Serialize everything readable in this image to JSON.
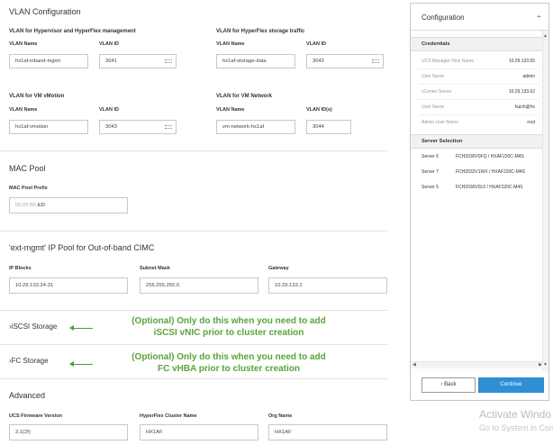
{
  "vlan": {
    "title": "VLAN Configuration",
    "groups": [
      {
        "title": "VLAN for Hypervisor and HyperFlex management",
        "name_label": "VLAN Name",
        "name_value": "hx1af-inband-mgmt",
        "id_label": "VLAN ID",
        "id_value": "3041"
      },
      {
        "title": "VLAN for HyperFlex storage traffic",
        "name_label": "VLAN Name",
        "name_value": "hx1af-storage-data",
        "id_label": "VLAN ID",
        "id_value": "3042"
      },
      {
        "title": "VLAN for VM vMotion",
        "name_label": "VLAN Name",
        "name_value": "hx1af-vmotion",
        "id_label": "VLAN ID",
        "id_value": "3043"
      },
      {
        "title": "VLAN for VM Network",
        "name_label": "VLAN Name",
        "name_value": "vm-network-hx1af",
        "id_label": "VLAN ID(s)",
        "id_value": "3044"
      }
    ]
  },
  "mac": {
    "title": "MAC Pool",
    "prefix_label": "MAC Pool Prefix",
    "prefix_value": "00:25:B5:",
    "prefix_suffix": "ED"
  },
  "ippool": {
    "title": "'ext-mgmt' IP Pool for Out-of-band CIMC",
    "blocks_label": "IP Blocks",
    "blocks_value": "10.29.133.24-31",
    "mask_label": "Subnet Mask",
    "mask_value": "255.255.255.0",
    "gateway_label": "Gateway",
    "gateway_value": "10.29.133.1"
  },
  "iscsi": {
    "label": "iSCSI Storage",
    "note_line1": "(Optional) Only do this when you need to add",
    "note_line2": "iSCSI vNIC prior to cluster creation"
  },
  "fc": {
    "label": "FC Storage",
    "note_line1": "(Optional) Only do this when you need to add",
    "note_line2": "FC vHBA prior to cluster creation"
  },
  "advanced": {
    "title": "Advanced",
    "fw_label": "UCS Firmware Version",
    "fw_value": "3.1(2f)",
    "cluster_label": "HyperFlex Cluster Name",
    "cluster_value": "HX1AF",
    "org_label": "Org Name",
    "org_value": "HX1AF"
  },
  "panel": {
    "title": "Configuration",
    "credentials_title": "Credentials",
    "credentials": [
      {
        "k": "UCS Manager Host Name",
        "v": "10.29.133.55"
      },
      {
        "k": "User Name",
        "v": "admin"
      },
      {
        "k": "vCenter Server",
        "v": "10.29.133.62"
      },
      {
        "k": "User Name",
        "v": "huich@hx"
      },
      {
        "k": "Admin User Name",
        "v": "root"
      }
    ],
    "server_title": "Server Selection",
    "servers": [
      {
        "name": "Server 6",
        "detail": "FCH2030V0FQ / HXAF220C-M4S"
      },
      {
        "name": "Server 7",
        "detail": "FCH2032V1WX / HXAF220C-M4S"
      },
      {
        "name": "Server 5",
        "detail": "FCH2030V0L0 / HXAF220C-M4S"
      }
    ],
    "back_label": "Back",
    "continue_label": "Continue"
  },
  "watermark": {
    "line1": "Activate Windo",
    "line2": "Go to System in Cont"
  },
  "colors": {
    "accent": "#2f8fd5",
    "note_green": "#5aa33b"
  }
}
